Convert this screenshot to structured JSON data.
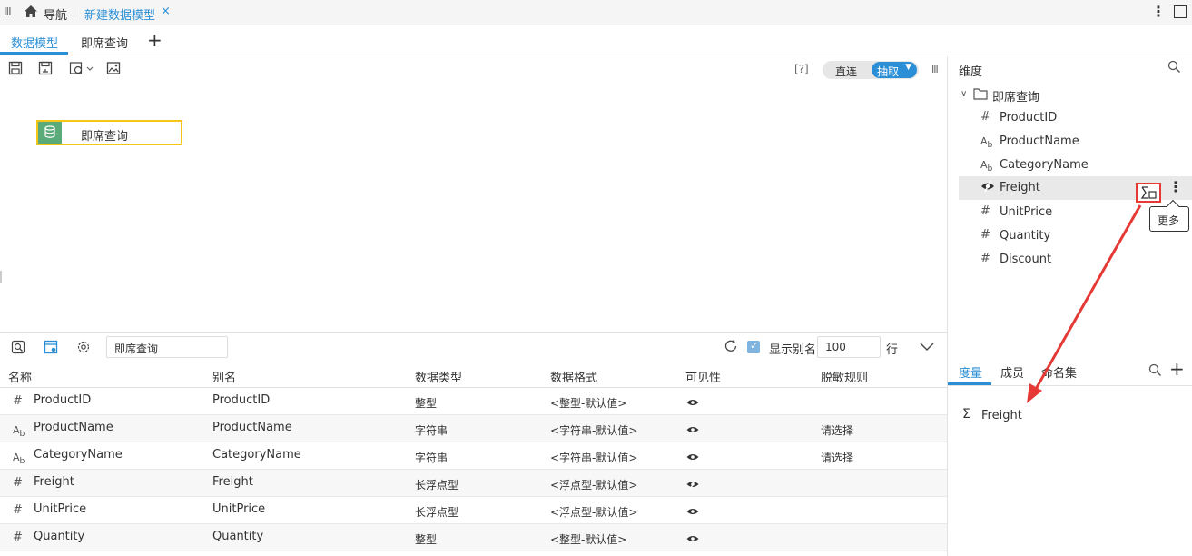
{
  "topbar": {
    "nav_label": "导航",
    "active_tab": "新建数据模型",
    "close": "×"
  },
  "tabs": {
    "data_model": "数据模型",
    "adhoc_query": "即席查询",
    "add": "+"
  },
  "toolbar": {
    "help": "[?]",
    "direct": "直连",
    "extract": "抽取"
  },
  "canvas": {
    "node_label": "即席查询"
  },
  "dimension_panel": {
    "title": "维度",
    "folder": "即席查询",
    "fields": [
      {
        "icon": "#",
        "type": "number",
        "label": "ProductID"
      },
      {
        "icon": "Ab",
        "type": "text",
        "label": "ProductName"
      },
      {
        "icon": "Ab",
        "type": "text",
        "label": "CategoryName"
      },
      {
        "icon": "hidden",
        "type": "hidden",
        "label": "Freight"
      },
      {
        "icon": "#",
        "type": "number",
        "label": "UnitPrice"
      },
      {
        "icon": "#",
        "type": "number",
        "label": "Quantity"
      },
      {
        "icon": "#",
        "type": "number",
        "label": "Discount"
      }
    ],
    "tooltip": "更多"
  },
  "measure_panel": {
    "tabs": [
      "度量",
      "成员",
      "命名集"
    ],
    "items": [
      {
        "label": "Freight"
      }
    ]
  },
  "bottom_toolbar": {
    "table_name": "即席查询",
    "show_alias": "显示别名",
    "rows_value": "100",
    "rows_unit": "行"
  },
  "table": {
    "columns": [
      "名称",
      "别名",
      "数据类型",
      "数据格式",
      "可见性",
      "脱敏规则"
    ],
    "rows": [
      {
        "icon": "#",
        "name": "ProductID",
        "alias": "ProductID",
        "dtype": "整型",
        "fmt": "<整型-默认值>",
        "visible": true,
        "mask": ""
      },
      {
        "icon": "Ab",
        "name": "ProductName",
        "alias": "ProductName",
        "dtype": "字符串",
        "fmt": "<字符串-默认值>",
        "visible": true,
        "mask": "请选择"
      },
      {
        "icon": "Ab",
        "name": "CategoryName",
        "alias": "CategoryName",
        "dtype": "字符串",
        "fmt": "<字符串-默认值>",
        "visible": true,
        "mask": "请选择"
      },
      {
        "icon": "#",
        "name": "Freight",
        "alias": "Freight",
        "dtype": "长浮点型",
        "fmt": "<浮点型-默认值>",
        "visible": false,
        "mask": ""
      },
      {
        "icon": "#",
        "name": "UnitPrice",
        "alias": "UnitPrice",
        "dtype": "长浮点型",
        "fmt": "<浮点型-默认值>",
        "visible": true,
        "mask": ""
      },
      {
        "icon": "#",
        "name": "Quantity",
        "alias": "Quantity",
        "dtype": "整型",
        "fmt": "<整型-默认值>",
        "visible": true,
        "mask": ""
      }
    ]
  },
  "colors": {
    "accent": "#2a8fd6",
    "highlight": "#e53935",
    "node_border": "#f5c518",
    "node_icon": "#5aaa7a"
  }
}
